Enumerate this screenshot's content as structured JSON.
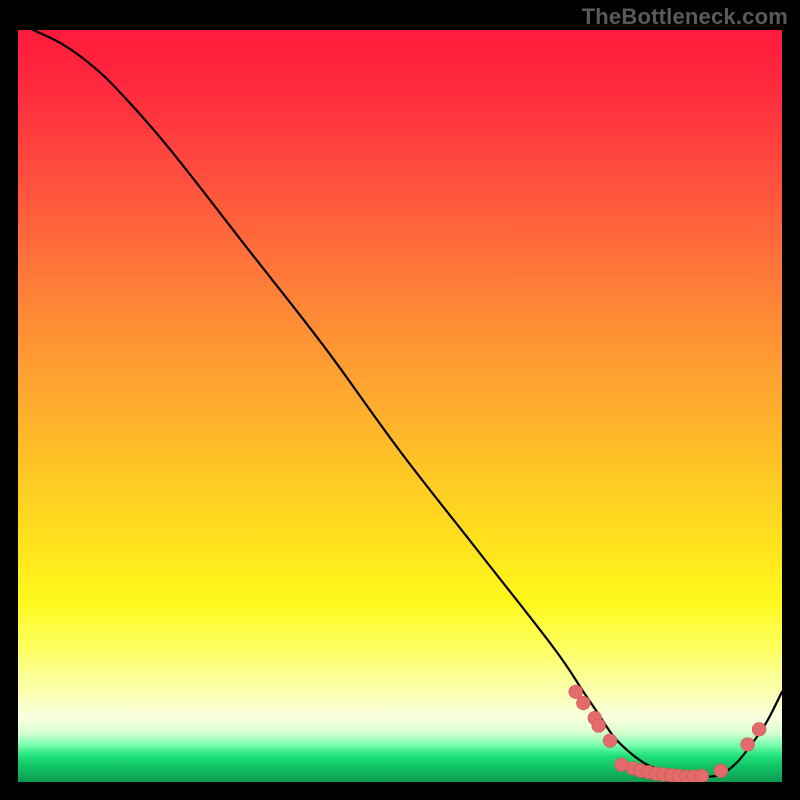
{
  "watermark": "TheBottleneck.com",
  "chart_data": {
    "type": "line",
    "title": "",
    "xlabel": "",
    "ylabel": "",
    "xlim": [
      0,
      100
    ],
    "ylim": [
      0,
      100
    ],
    "grid": false,
    "series": [
      {
        "name": "bottleneck-curve",
        "x": [
          2,
          6,
          10,
          14,
          20,
          30,
          40,
          50,
          60,
          70,
          74,
          76,
          78,
          80,
          82,
          84,
          86,
          88,
          90,
          92,
          94,
          96,
          98,
          100
        ],
        "y": [
          100,
          98,
          95,
          91,
          84,
          71,
          58,
          44,
          31,
          18,
          12,
          9,
          6,
          4,
          2.5,
          1.6,
          1.0,
          0.7,
          0.7,
          1.0,
          2.5,
          5,
          8,
          12
        ]
      }
    ],
    "markers": {
      "name": "salmon-dot-cluster",
      "points": [
        {
          "x": 73,
          "y": 12
        },
        {
          "x": 74,
          "y": 10.5
        },
        {
          "x": 75.5,
          "y": 8.5
        },
        {
          "x": 76,
          "y": 7.5
        },
        {
          "x": 77.5,
          "y": 5.5
        },
        {
          "x": 79,
          "y": 2.3
        },
        {
          "x": 80.5,
          "y": 1.8
        },
        {
          "x": 81.5,
          "y": 1.5
        },
        {
          "x": 82.5,
          "y": 1.3
        },
        {
          "x": 83.5,
          "y": 1.1
        },
        {
          "x": 84.5,
          "y": 1.0
        },
        {
          "x": 85.5,
          "y": 0.9
        },
        {
          "x": 86.5,
          "y": 0.8
        },
        {
          "x": 87.5,
          "y": 0.7
        },
        {
          "x": 88.5,
          "y": 0.7
        },
        {
          "x": 89.5,
          "y": 0.8
        },
        {
          "x": 92,
          "y": 1.5
        },
        {
          "x": 95.5,
          "y": 5
        },
        {
          "x": 97,
          "y": 7
        }
      ]
    },
    "background_gradient": {
      "top": "#ff1a3c",
      "mid": "#ffe11d",
      "band": "#20e27a",
      "bottom": "#0d9a52"
    }
  }
}
